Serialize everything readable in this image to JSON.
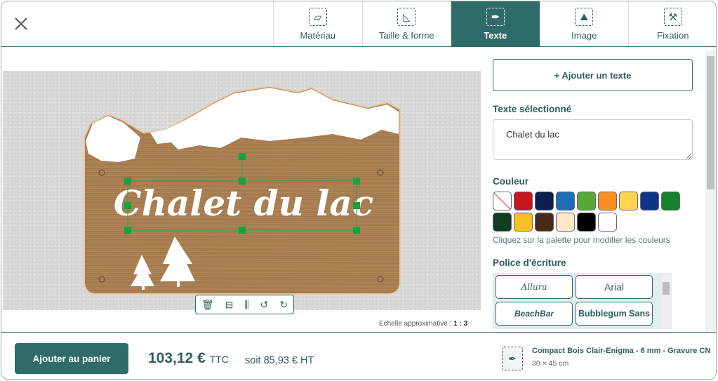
{
  "tabs": [
    {
      "label": "Matériau",
      "icon": "material-icon"
    },
    {
      "label": "Taille & forme",
      "icon": "size-shape-icon"
    },
    {
      "label": "Texte",
      "icon": "pen-nib-icon",
      "active": true
    },
    {
      "label": "Image",
      "icon": "image-icon"
    },
    {
      "label": "Fixation",
      "icon": "screw-icon"
    }
  ],
  "canvas": {
    "sign_text": "Chalet du lac",
    "scale_label": "Echelle approximative :",
    "scale_value": "1 : 3"
  },
  "panel": {
    "add_text": "+ Ajouter un texte",
    "selected_label": "Texte sélectionné",
    "selected_value": "Chalet du lac",
    "color_label": "Couleur",
    "colors": [
      "none",
      "#c8161d",
      "#0d1f4f",
      "#1f6db5",
      "#56a935",
      "#f7901e",
      "#fdd54f",
      "#0e3488",
      "#16812d",
      "#0f3d20",
      "#fbbf24",
      "#4a2a1a",
      "#fde9c9",
      "#000000",
      "#ffffff"
    ],
    "color_hint": "Cliquez sur la palette pour modifier les couleurs",
    "font_label": "Police d'écriture",
    "fonts": [
      "Allura",
      "Arial",
      "BeachBar",
      "Bubblegum Sans"
    ]
  },
  "footer": {
    "cart": "Ajouter au panier",
    "price": "103,12 €",
    "ttc": "TTC",
    "ht": "soit 85,93 € HT",
    "product": "Compact Bois Clair-Enigma - 6 mm - Gravure CN",
    "size": "30 × 45 cm"
  },
  "accent": "#2f6b69"
}
